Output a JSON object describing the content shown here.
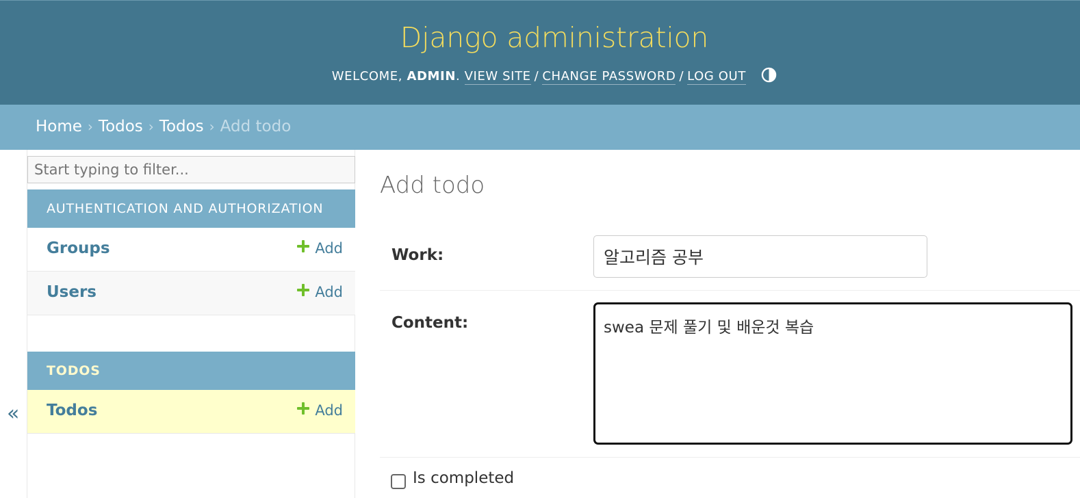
{
  "header": {
    "site_name": "Django administration",
    "welcome_text": "Welcome,",
    "username": "admin",
    "view_site": "View site",
    "change_password": "Change password",
    "log_out": "Log out",
    "separator": "/",
    "theme_icon": "half-circle-theme-icon"
  },
  "breadcrumbs": {
    "home": "Home",
    "app": "Todos",
    "model": "Todos",
    "current": "Add todo",
    "arrow": "›"
  },
  "sidebar": {
    "collapse_glyph": "«",
    "filter_placeholder": "Start typing to filter...",
    "apps": [
      {
        "caption": "Authentication and Authorization",
        "models": [
          {
            "name": "Groups",
            "add_label": "Add"
          },
          {
            "name": "Users",
            "add_label": "Add"
          }
        ]
      },
      {
        "caption": "Todos",
        "models": [
          {
            "name": "Todos",
            "add_label": "Add"
          }
        ]
      }
    ]
  },
  "form": {
    "title": "Add todo",
    "work": {
      "label": "Work:",
      "value": "알고리즘 공부"
    },
    "content": {
      "label": "Content:",
      "value": "swea 문제 풀기 및 배운것 복습"
    },
    "is_completed": {
      "label": "Is completed",
      "checked": false
    }
  },
  "colors": {
    "header_bg": "#42768e",
    "site_name": "#f5dd5d",
    "breadcrumbs_bg": "#79aec8",
    "caption_bg": "#79aec8",
    "link": "#447e9b",
    "add_plus": "#70bf2b",
    "current_row": "#ffffcc"
  }
}
